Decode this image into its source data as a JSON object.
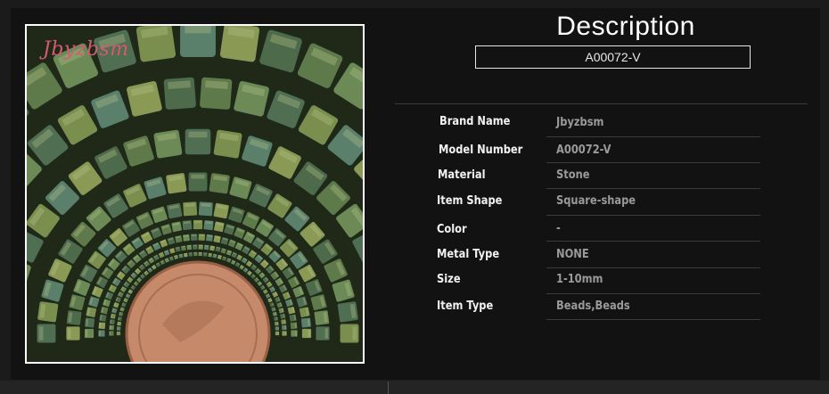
{
  "header": {
    "title": "Description",
    "model_code": "A00072-V"
  },
  "photo": {
    "brand_mark": "Jbyzbsm",
    "alt": "green hematite square beads around a coin",
    "accent_color": "#d45a72"
  },
  "specs": [
    {
      "label": "Brand Name",
      "value": "Jbyzbsm"
    },
    {
      "label": "Model Number",
      "value": "A00072-V"
    },
    {
      "label": "Material",
      "value": "Stone"
    },
    {
      "label": "Item Shape",
      "value": "Square-shape"
    },
    {
      "label": "Color",
      "value": "-"
    },
    {
      "label": "Metal Type",
      "value": "NONE"
    },
    {
      "label": "Size",
      "value": "1-10mm"
    },
    {
      "label": "Item Type",
      "value": "Beads,Beads"
    }
  ],
  "colors": {
    "panel": "#121212",
    "label": "#f2f2f2",
    "value": "#9a9a9a"
  }
}
